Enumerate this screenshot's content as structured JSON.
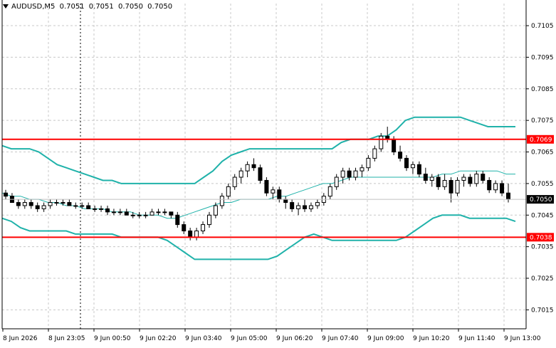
{
  "header": {
    "symbol": "AUDUSD,M5",
    "ohlc": [
      "0.7051",
      "0.7051",
      "0.7050",
      "0.7050"
    ]
  },
  "colors": {
    "background": "#ffffff",
    "grid": "#c8c8c8",
    "axis": "#000000",
    "candle": "#000000",
    "bollinger": "#20b2aa",
    "level_line": "#ff0000",
    "level_tag_bg": "#ff0000",
    "level_tag_text": "#ffffff",
    "current_tag_bg": "#000000",
    "current_tag_text": "#ffffff"
  },
  "price_axis": {
    "labels": [
      "0.7105",
      "0.7095",
      "0.7085",
      "0.7075",
      "0.7065",
      "0.7055",
      "0.7045",
      "0.7035",
      "0.7025",
      "0.7015"
    ]
  },
  "time_axis": {
    "labels": [
      "8 Jun 2026",
      "8 Jun 23:05",
      "9 Jun 00:50",
      "9 Jun 02:20",
      "9 Jun 03:40",
      "9 Jun 05:00",
      "9 Jun 06:20",
      "9 Jun 07:40",
      "9 Jun 09:00",
      "9 Jun 10:20",
      "9 Jun 11:40",
      "9 Jun 13:00"
    ]
  },
  "levels": [
    {
      "price": 0.7069,
      "label": "0.7069"
    },
    {
      "price": 0.7038,
      "label": "0.7038"
    }
  ],
  "current_price": {
    "price": 0.705,
    "label": "0.7050"
  },
  "chart_data": {
    "type": "candlestick",
    "symbol": "AUDUSD",
    "timeframe": "M5",
    "y_range": [
      0.7009,
      0.7112
    ],
    "indicator": "Bollinger Bands",
    "day_separator_time": "8 Jun 23:05",
    "candles": [
      [
        0.7052,
        0.7053,
        0.705,
        0.7051
      ],
      [
        0.7051,
        0.7052,
        0.7049,
        0.7049
      ],
      [
        0.7049,
        0.705,
        0.7047,
        0.7048
      ],
      [
        0.7048,
        0.705,
        0.7047,
        0.7049
      ],
      [
        0.7049,
        0.705,
        0.7047,
        0.7048
      ],
      [
        0.7048,
        0.7049,
        0.7046,
        0.7047
      ],
      [
        0.7047,
        0.7049,
        0.7046,
        0.7048
      ],
      [
        0.7048,
        0.705,
        0.7047,
        0.7049
      ],
      [
        0.7049,
        0.705,
        0.7048,
        0.7049
      ],
      [
        0.7049,
        0.705,
        0.7048,
        0.7049
      ],
      [
        0.7049,
        0.705,
        0.7048,
        0.7048
      ],
      [
        0.7048,
        0.7049,
        0.7047,
        0.7048
      ],
      [
        0.7048,
        0.7049,
        0.7047,
        0.7048
      ],
      [
        0.7048,
        0.7049,
        0.7047,
        0.7047
      ],
      [
        0.7047,
        0.7048,
        0.7046,
        0.7047
      ],
      [
        0.7047,
        0.7048,
        0.7046,
        0.7047
      ],
      [
        0.7047,
        0.7048,
        0.7045,
        0.7046
      ],
      [
        0.7046,
        0.7047,
        0.7045,
        0.7046
      ],
      [
        0.7046,
        0.7047,
        0.7045,
        0.7046
      ],
      [
        0.7046,
        0.7047,
        0.7045,
        0.7045
      ],
      [
        0.7045,
        0.7046,
        0.7044,
        0.7045
      ],
      [
        0.7045,
        0.7046,
        0.7044,
        0.7045
      ],
      [
        0.7045,
        0.7046,
        0.7044,
        0.7045
      ],
      [
        0.7045,
        0.7047,
        0.7045,
        0.7046
      ],
      [
        0.7046,
        0.7047,
        0.7045,
        0.7046
      ],
      [
        0.7046,
        0.7047,
        0.7045,
        0.7046
      ],
      [
        0.7046,
        0.7046,
        0.7044,
        0.7045
      ],
      [
        0.7045,
        0.7046,
        0.7041,
        0.7042
      ],
      [
        0.7042,
        0.7043,
        0.7039,
        0.704
      ],
      [
        0.704,
        0.7041,
        0.7037,
        0.7038
      ],
      [
        0.7038,
        0.7041,
        0.7037,
        0.704
      ],
      [
        0.704,
        0.7043,
        0.7039,
        0.7042
      ],
      [
        0.7042,
        0.7046,
        0.7041,
        0.7045
      ],
      [
        0.7045,
        0.7049,
        0.7044,
        0.7048
      ],
      [
        0.7048,
        0.7052,
        0.7047,
        0.7051
      ],
      [
        0.7051,
        0.7055,
        0.705,
        0.7054
      ],
      [
        0.7054,
        0.7058,
        0.7053,
        0.7057
      ],
      [
        0.7057,
        0.706,
        0.7055,
        0.7059
      ],
      [
        0.7059,
        0.7062,
        0.7057,
        0.7061
      ],
      [
        0.7061,
        0.7063,
        0.7059,
        0.706
      ],
      [
        0.706,
        0.7061,
        0.7055,
        0.7056
      ],
      [
        0.7056,
        0.7057,
        0.7051,
        0.7052
      ],
      [
        0.7052,
        0.7054,
        0.705,
        0.7053
      ],
      [
        0.7053,
        0.7054,
        0.7049,
        0.705
      ],
      [
        0.705,
        0.7051,
        0.7047,
        0.7049
      ],
      [
        0.7049,
        0.705,
        0.7046,
        0.7047
      ],
      [
        0.7047,
        0.7049,
        0.7045,
        0.7048
      ],
      [
        0.7048,
        0.705,
        0.7046,
        0.7047
      ],
      [
        0.7047,
        0.7049,
        0.7046,
        0.7048
      ],
      [
        0.7048,
        0.705,
        0.7047,
        0.7049
      ],
      [
        0.7049,
        0.7052,
        0.7048,
        0.7051
      ],
      [
        0.7051,
        0.7055,
        0.705,
        0.7054
      ],
      [
        0.7054,
        0.7058,
        0.7053,
        0.7057
      ],
      [
        0.7057,
        0.706,
        0.7055,
        0.7059
      ],
      [
        0.7059,
        0.706,
        0.7056,
        0.7057
      ],
      [
        0.7057,
        0.706,
        0.7056,
        0.7059
      ],
      [
        0.7059,
        0.7061,
        0.7057,
        0.706
      ],
      [
        0.706,
        0.7064,
        0.7059,
        0.7063
      ],
      [
        0.7063,
        0.7067,
        0.7062,
        0.7066
      ],
      [
        0.7066,
        0.7071,
        0.7065,
        0.707
      ],
      [
        0.707,
        0.7073,
        0.7068,
        0.7069
      ],
      [
        0.7069,
        0.707,
        0.7064,
        0.7065
      ],
      [
        0.7065,
        0.7067,
        0.7062,
        0.7063
      ],
      [
        0.7063,
        0.7064,
        0.7059,
        0.706
      ],
      [
        0.706,
        0.7062,
        0.7058,
        0.7061
      ],
      [
        0.7061,
        0.7062,
        0.7057,
        0.7058
      ],
      [
        0.7058,
        0.706,
        0.7055,
        0.7056
      ],
      [
        0.7056,
        0.7058,
        0.7054,
        0.7057
      ],
      [
        0.7057,
        0.7058,
        0.7053,
        0.7054
      ],
      [
        0.7054,
        0.7058,
        0.7053,
        0.7056
      ],
      [
        0.7056,
        0.7057,
        0.7049,
        0.7052
      ],
      [
        0.7052,
        0.7057,
        0.7051,
        0.7056
      ],
      [
        0.7056,
        0.7058,
        0.7054,
        0.7057
      ],
      [
        0.7057,
        0.7058,
        0.7054,
        0.7055
      ],
      [
        0.7055,
        0.7059,
        0.7054,
        0.7058
      ],
      [
        0.7058,
        0.7059,
        0.7055,
        0.7056
      ],
      [
        0.7056,
        0.7057,
        0.7052,
        0.7053
      ],
      [
        0.7053,
        0.7056,
        0.7052,
        0.7055
      ],
      [
        0.7055,
        0.7056,
        0.7051,
        0.7052
      ],
      [
        0.7052,
        0.7055,
        0.7049,
        0.705
      ]
    ],
    "bollinger": {
      "upper": [
        0.7067,
        0.7066,
        0.7066,
        0.7066,
        0.7065,
        0.7063,
        0.7061,
        0.706,
        0.7059,
        0.7058,
        0.7057,
        0.7056,
        0.7056,
        0.7055,
        0.7055,
        0.7055,
        0.7055,
        0.7055,
        0.7055,
        0.7055,
        0.7055,
        0.7055,
        0.7057,
        0.7059,
        0.7062,
        0.7064,
        0.7065,
        0.7066,
        0.7066,
        0.7066,
        0.7066,
        0.7066,
        0.7066,
        0.7066,
        0.7066,
        0.7066,
        0.7066,
        0.7068,
        0.7069,
        0.7069,
        0.7069,
        0.707,
        0.707,
        0.7072,
        0.7075,
        0.7076,
        0.7076,
        0.7076,
        0.7076,
        0.7076,
        0.7076,
        0.7075,
        0.7074,
        0.7073,
        0.7073,
        0.7073,
        0.7073
      ],
      "middle": [
        0.7052,
        0.7051,
        0.7051,
        0.705,
        0.705,
        0.7049,
        0.7049,
        0.7048,
        0.7048,
        0.7047,
        0.7047,
        0.7047,
        0.7046,
        0.7046,
        0.7046,
        0.7045,
        0.7045,
        0.7045,
        0.7044,
        0.7044,
        0.7045,
        0.7046,
        0.7047,
        0.7048,
        0.7049,
        0.7049,
        0.705,
        0.705,
        0.705,
        0.705,
        0.7051,
        0.7051,
        0.7052,
        0.7053,
        0.7054,
        0.7055,
        0.7055,
        0.7056,
        0.7057,
        0.7057,
        0.7057,
        0.7057,
        0.7057,
        0.7057,
        0.7057,
        0.7057,
        0.7057,
        0.7057,
        0.7058,
        0.7058,
        0.7059,
        0.7059,
        0.7059,
        0.7059,
        0.7059,
        0.7058,
        0.7058
      ],
      "lower": [
        0.7044,
        0.7043,
        0.7041,
        0.704,
        0.704,
        0.704,
        0.704,
        0.704,
        0.7039,
        0.7039,
        0.7039,
        0.7039,
        0.7039,
        0.7038,
        0.7038,
        0.7038,
        0.7038,
        0.7038,
        0.7037,
        0.7035,
        0.7033,
        0.7031,
        0.7031,
        0.7031,
        0.7031,
        0.7031,
        0.7031,
        0.7031,
        0.7031,
        0.7031,
        0.7032,
        0.7034,
        0.7036,
        0.7038,
        0.7039,
        0.7038,
        0.7037,
        0.7037,
        0.7037,
        0.7037,
        0.7037,
        0.7037,
        0.7037,
        0.7037,
        0.7038,
        0.704,
        0.7042,
        0.7044,
        0.7045,
        0.7045,
        0.7045,
        0.7044,
        0.7044,
        0.7044,
        0.7044,
        0.7044,
        0.7043
      ]
    }
  }
}
